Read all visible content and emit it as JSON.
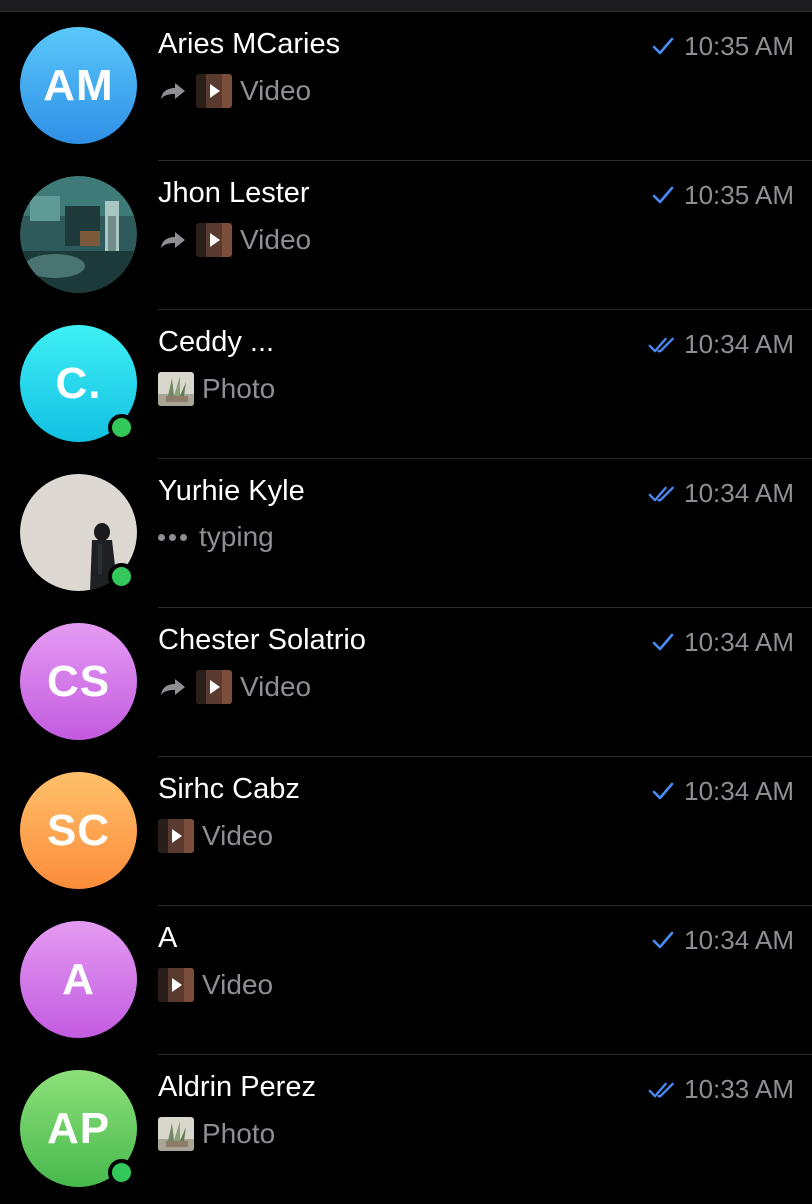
{
  "colors": {
    "background": "#000000",
    "name_text": "#ffffff",
    "secondary_text": "#8e8e93",
    "read_check": "#4a8cf7",
    "online": "#34c759"
  },
  "chats": [
    {
      "name": "Aries MCaries",
      "time": "10:35 AM",
      "status": "sent",
      "avatar": {
        "type": "initials",
        "text": "AM",
        "gradient": [
          "#5ac8fa",
          "#2f8fe6"
        ]
      },
      "online": false,
      "preview": {
        "kind": "forwarded-video",
        "text": "Video"
      }
    },
    {
      "name": "Jhon Lester",
      "time": "10:35 AM",
      "status": "sent",
      "avatar": {
        "type": "photo",
        "description": "room-scene"
      },
      "online": false,
      "preview": {
        "kind": "forwarded-video",
        "text": "Video"
      }
    },
    {
      "name": "Ceddy ...",
      "time": "10:34 AM",
      "status": "read",
      "avatar": {
        "type": "initials",
        "text": "C.",
        "gradient": [
          "#3ff0f5",
          "#12c0e2"
        ]
      },
      "online": true,
      "preview": {
        "kind": "photo",
        "text": "Photo"
      }
    },
    {
      "name": "Yurhie Kyle",
      "time": "10:34 AM",
      "status": "read",
      "avatar": {
        "type": "photo",
        "description": "person-by-wall"
      },
      "online": true,
      "preview": {
        "kind": "typing",
        "text": "typing"
      }
    },
    {
      "name": "Chester Solatrio",
      "time": "10:34 AM",
      "status": "sent",
      "avatar": {
        "type": "initials",
        "text": "CS",
        "gradient": [
          "#e49bf2",
          "#c35be0"
        ]
      },
      "online": false,
      "preview": {
        "kind": "forwarded-video",
        "text": "Video"
      }
    },
    {
      "name": "Sirhc Cabz",
      "time": "10:34 AM",
      "status": "sent",
      "avatar": {
        "type": "initials",
        "text": "SC",
        "gradient": [
          "#ffc06a",
          "#fb8c3b"
        ]
      },
      "online": false,
      "preview": {
        "kind": "video",
        "text": "Video"
      }
    },
    {
      "name": "A",
      "time": "10:34 AM",
      "status": "sent",
      "avatar": {
        "type": "initials",
        "text": "A",
        "gradient": [
          "#e49bf2",
          "#c35be0"
        ]
      },
      "online": false,
      "preview": {
        "kind": "video",
        "text": "Video"
      }
    },
    {
      "name": "Aldrin Perez",
      "time": "10:33 AM",
      "status": "read",
      "avatar": {
        "type": "initials",
        "text": "AP",
        "gradient": [
          "#8ee07a",
          "#47b94d"
        ]
      },
      "online": true,
      "preview": {
        "kind": "photo",
        "text": "Photo"
      }
    }
  ]
}
